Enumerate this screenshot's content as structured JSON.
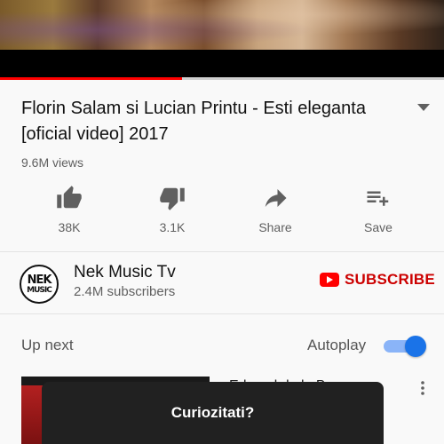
{
  "video": {
    "progress_fraction": 0.41
  },
  "title": "Florin Salam si Lucian Printu - Esti eleganta [oficial video] 2017",
  "views": "9.6M views",
  "actions": [
    {
      "label": "38K",
      "icon": "thumb-up-icon"
    },
    {
      "label": "3.1K",
      "icon": "thumb-down-icon"
    },
    {
      "label": "Share",
      "icon": "share-icon"
    },
    {
      "label": "Save",
      "icon": "playlist-add-icon"
    }
  ],
  "channel": {
    "name": "Nek Music Tv",
    "subscribers": "2.4M subscribers",
    "avatar_text_top": "NEK",
    "avatar_text_bottom": "MUSIC"
  },
  "subscribe": {
    "label": "SUBSCRIBE",
    "color": "#cc0000"
  },
  "up_next": {
    "label": "Up next",
    "autoplay_label": "Autoplay",
    "autoplay_on": true,
    "next_title_partial": "Edward de la Brasa"
  },
  "overlay": {
    "label": "Curiozitati?"
  },
  "colors": {
    "accent": "#ff0000",
    "toggle": "#1a73e8"
  }
}
